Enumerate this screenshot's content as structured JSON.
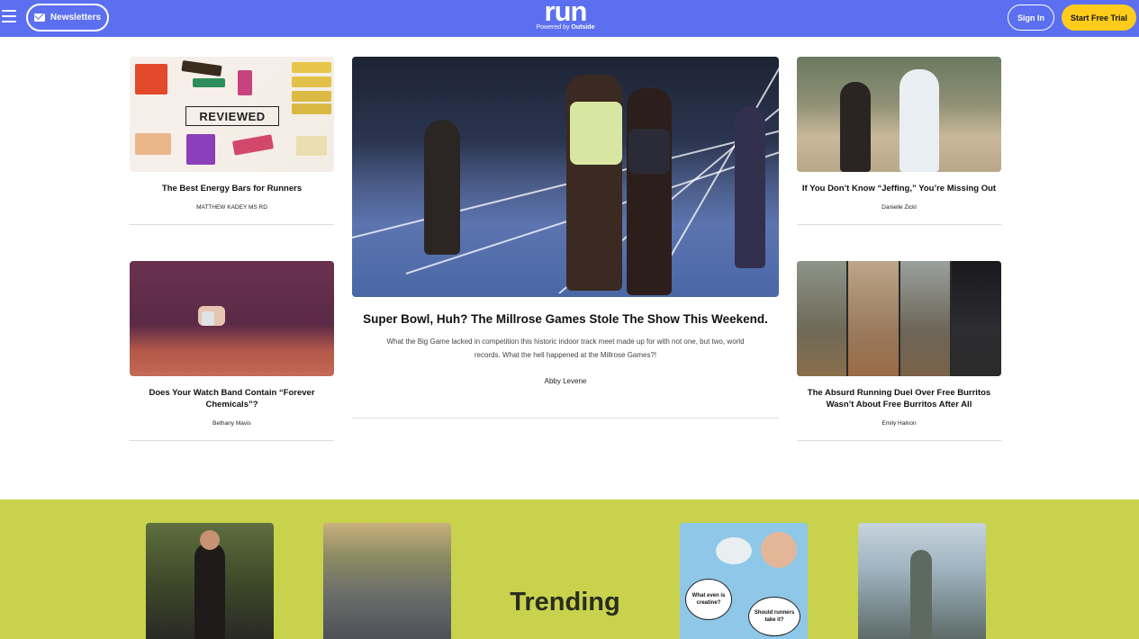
{
  "header": {
    "menu_icon": "hamburger-icon",
    "newsletters_label": "Newsletters",
    "newsletters_icon": "mail-icon",
    "logo_word": "run",
    "logo_powered": "Powered by",
    "logo_brand": "Outside",
    "signin_label": "Sign In",
    "trial_label": "Start Free Trial",
    "colors": {
      "bar": "#5b6ff0",
      "trial": "#ffcc1c"
    }
  },
  "articles": {
    "energy_bars": {
      "title": "The Best Energy Bars for Runners",
      "byline": "MATTHEW KADEY MS RD",
      "image_text": "REVIEWED"
    },
    "main": {
      "title": "Super Bowl, Huh? The Millrose Games Stole The Show This Weekend.",
      "dek": "What the Big Game lacked in competition this historic indoor track meet made up for with not one, but two, world records. What the hell happened at the Millrose Games?!",
      "byline": "Abby Levene"
    },
    "jeffing": {
      "title": "If You Don’t Know “Jeffing,” You’re Missing Out",
      "byline": "Danielle Zickl"
    },
    "watch_band": {
      "title": "Does Your Watch Band Contain “Forever Chemicals”?",
      "byline": "Bethany Mavis"
    },
    "burritos": {
      "title": "The Absurd Running Duel Over Free Burritos Wasn’t About Free Burritos After All",
      "byline": "Emily Halnon"
    }
  },
  "trending": {
    "label": "Trending",
    "background": "#c9d24c",
    "bubble_1": "What even is creatine?",
    "bubble_2": "Should runners take it?"
  }
}
